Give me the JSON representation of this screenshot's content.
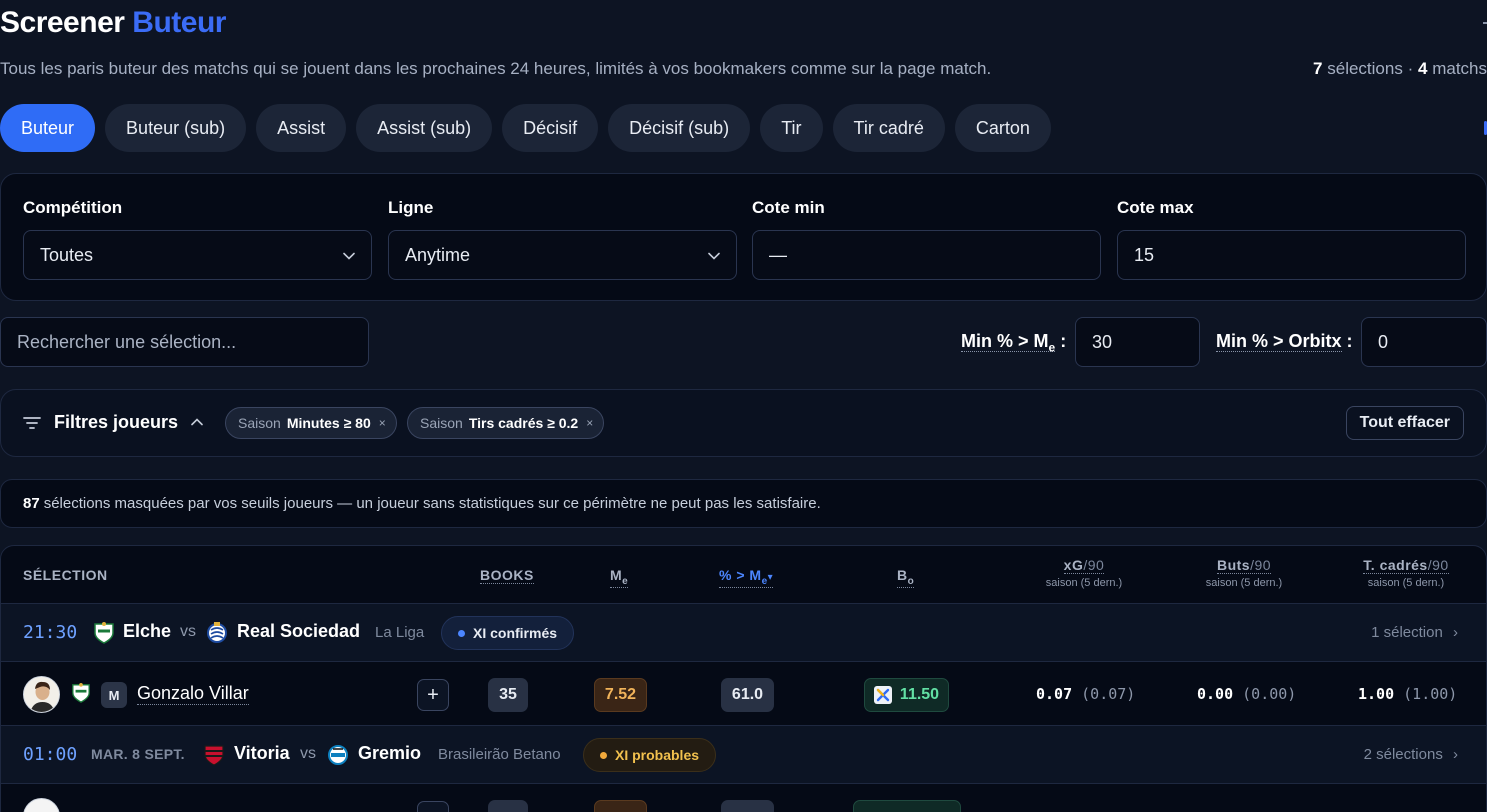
{
  "header": {
    "title_main": "Screener",
    "title_accent": "Buteur",
    "subtitle": "Tous les paris buteur des matchs qui se jouent dans les prochaines 24 heures, limités à vos bookmakers comme sur la page match.",
    "selections_count": "7",
    "selections_label": "sélections",
    "separator": "·",
    "matches_count": "4",
    "matches_label": "matchs"
  },
  "tabs": [
    {
      "label": "Buteur",
      "active": true
    },
    {
      "label": "Buteur (sub)",
      "active": false
    },
    {
      "label": "Assist",
      "active": false
    },
    {
      "label": "Assist (sub)",
      "active": false
    },
    {
      "label": "Décisif",
      "active": false
    },
    {
      "label": "Décisif (sub)",
      "active": false
    },
    {
      "label": "Tir",
      "active": false
    },
    {
      "label": "Tir cadré",
      "active": false
    },
    {
      "label": "Carton",
      "active": false
    }
  ],
  "filters": {
    "competition": {
      "label": "Compétition",
      "value": "Toutes"
    },
    "line": {
      "label": "Ligne",
      "value": "Anytime"
    },
    "odds_min": {
      "label": "Cote min",
      "value": "—"
    },
    "odds_max": {
      "label": "Cote max",
      "value": "15"
    }
  },
  "search": {
    "placeholder": "Rechercher une sélection..."
  },
  "min_me": {
    "label_prefix": "Min % > M",
    "label_sub": "e",
    "colon": ":",
    "value": "30"
  },
  "min_orbitx": {
    "label": "Min % > Orbitx",
    "colon": ":",
    "value": "0"
  },
  "player_filters": {
    "title": "Filtres joueurs",
    "caret": "⌃",
    "chips": [
      {
        "key": "Saison",
        "value": "Minutes ≥ 80",
        "close": "×"
      },
      {
        "key": "Saison",
        "value": "Tirs cadrés ≥ 0.2",
        "close": "×"
      }
    ],
    "clear_label": "Tout effacer"
  },
  "notice": {
    "count": "87",
    "text": "sélections masquées par vos seuils joueurs — un joueur sans statistiques sur ce périmètre ne peut pas les satisfaire."
  },
  "table": {
    "headers": {
      "selection": "SÉLECTION",
      "books": "BOOKS",
      "me": "M",
      "me_sub": "e",
      "pct_me": "% > M",
      "pct_me_sub": "e",
      "sort_arrow": "▾",
      "bo": "B",
      "bo_sub": "o",
      "xg": "xG",
      "buts": "Buts",
      "tcadres": "T. cadrés",
      "per90": "/90",
      "season_note": "saison (5 dern.)"
    },
    "matches": [
      {
        "time": "21:30",
        "date": "",
        "home": "Elche",
        "vs": "vs",
        "away": "Real Sociedad",
        "league": "La Liga",
        "xi_status": "XI confirmés",
        "selections": "1 sélection",
        "chevron": "›"
      },
      {
        "time": "01:00",
        "date": "MAR. 8 SEPT.",
        "home": "Vitoria",
        "vs": "vs",
        "away": "Gremio",
        "league": "Brasileirão Betano",
        "xi_status": "XI probables",
        "selections": "2 sélections",
        "chevron": "›"
      }
    ],
    "players": [
      {
        "position": "M",
        "name": "Gonzalo Villar",
        "add": "+",
        "books": "35",
        "me": "7.52",
        "pct_me": "61.0",
        "bo": "11.50",
        "xg": "0.07",
        "xg_last5": "(0.07)",
        "goals": "0.00",
        "goals_last5": "(0.00)",
        "shots_on_target": "1.00",
        "shots_on_target_last5": "(1.00)"
      }
    ]
  },
  "colors": {
    "accent": "#3b6cf6",
    "background": "#0d1423",
    "positive": "#62e0a4",
    "warning": "#f2b45a"
  }
}
